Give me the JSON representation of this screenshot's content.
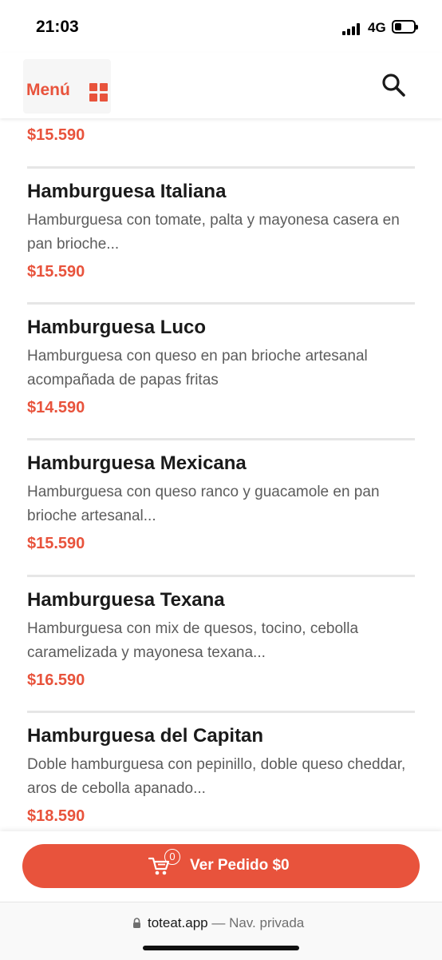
{
  "status_bar": {
    "time": "21:03",
    "network": "4G"
  },
  "header": {
    "menu_label": "Menú"
  },
  "top_price": "$15.590",
  "items": [
    {
      "name": "Hamburguesa Italiana",
      "description": "Hamburguesa con tomate, palta y mayonesa casera en pan brioche...",
      "price": "$15.590"
    },
    {
      "name": "Hamburguesa Luco",
      "description": "Hamburguesa con queso en pan brioche artesanal acompañada de papas fritas",
      "price": "$14.590"
    },
    {
      "name": "Hamburguesa Mexicana",
      "description": "Hamburguesa con queso ranco y guacamole en pan brioche artesanal...",
      "price": "$15.590"
    },
    {
      "name": "Hamburguesa Texana",
      "description": "Hamburguesa con mix de quesos, tocino, cebolla caramelizada y mayonesa texana...",
      "price": "$16.590"
    },
    {
      "name": "Hamburguesa del Capitan",
      "description": "Doble hamburguesa con pepinillo, doble queso cheddar, aros de cebolla apanado...",
      "price": "$18.590"
    }
  ],
  "order": {
    "cart_count": "0",
    "label": "Ver Pedido $0"
  },
  "browser": {
    "url": "toteat.app",
    "mode": " — Nav. privada"
  },
  "colors": {
    "accent": "#e8533c",
    "text": "#1a1a1a",
    "muted": "#5c5c5c",
    "divider": "#e6e6e6"
  },
  "icons": [
    "grid-icon",
    "search-icon",
    "cart-icon",
    "lock-icon",
    "signal-icon",
    "battery-icon"
  ]
}
